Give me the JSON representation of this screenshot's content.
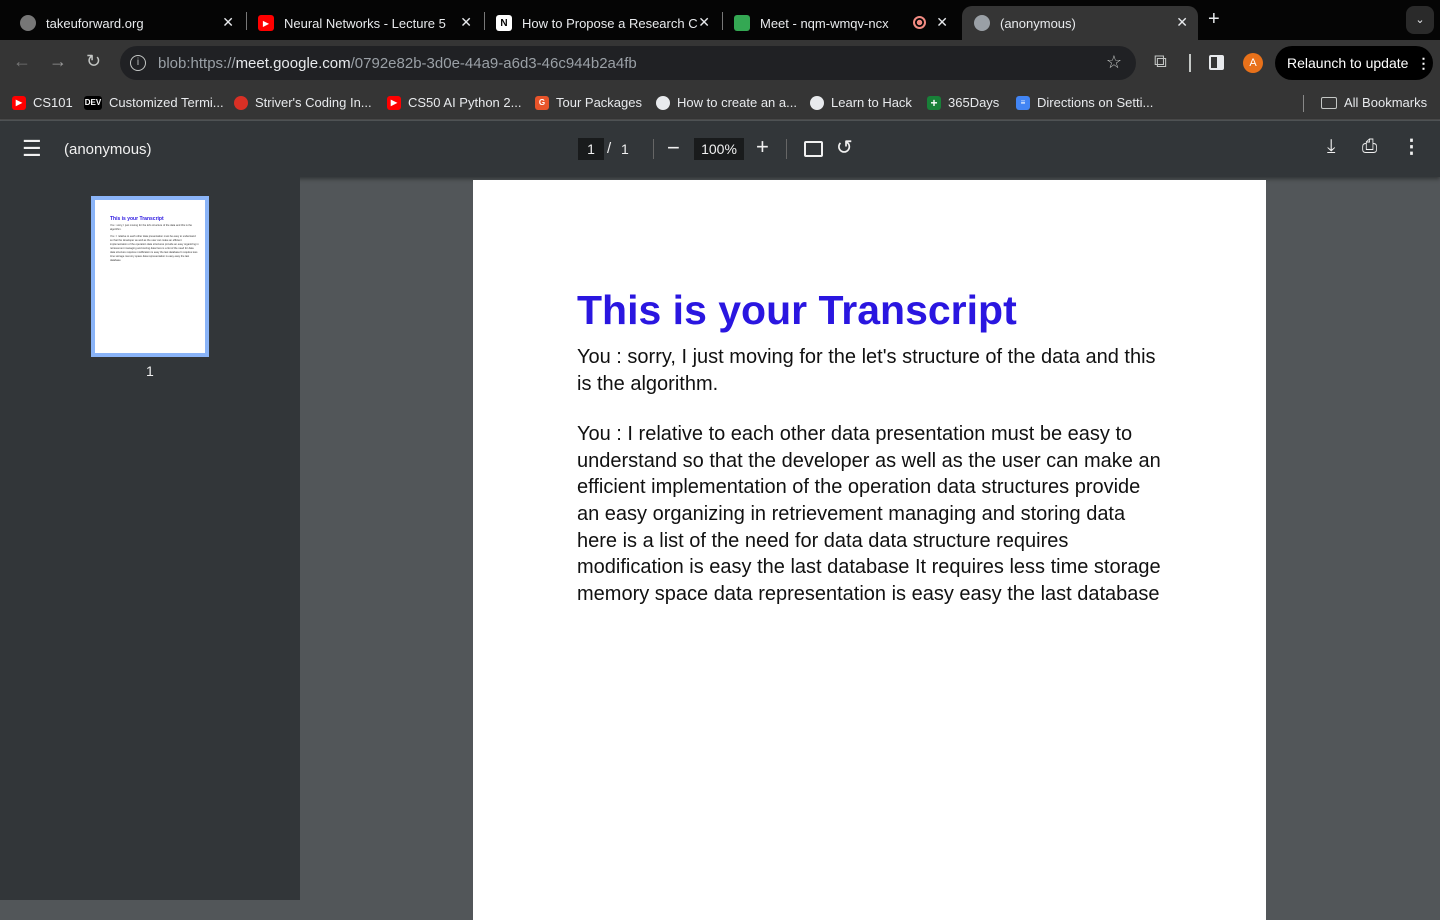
{
  "tabs": [
    {
      "title": "takeuforward.org",
      "color": "#777777"
    },
    {
      "title": "Neural Networks - Lecture 5",
      "color": "#ff0000"
    },
    {
      "title": "How to Propose a Research C",
      "color": "#222222"
    },
    {
      "title": "Meet - nqm-wmqv-ncx",
      "color": "#34a853"
    },
    {
      "title": "(anonymous)",
      "color": "#9aa0a6",
      "active": true
    }
  ],
  "address": {
    "prefix": "blob:https://",
    "host": "meet.google.com",
    "path": "/0792e82b-3d0e-44a9-a6d3-46c944b2a4fb"
  },
  "profile_initial": "A",
  "relaunch_label": "Relaunch to update",
  "bookmarks": [
    {
      "label": "CS101",
      "color": "#ff0000"
    },
    {
      "label": "Customized Termi...",
      "color": "#000000",
      "badge": "DEV"
    },
    {
      "label": "Striver's Coding In...",
      "color": "#d93025"
    },
    {
      "label": "CS50 AI Python 2...",
      "color": "#ff0000"
    },
    {
      "label": "Tour Packages",
      "color": "#e8542a",
      "badge": "G"
    },
    {
      "label": "How to create an a...",
      "color": "#5f6368"
    },
    {
      "label": "Learn to Hack",
      "color": "#5f6368"
    },
    {
      "label": "365Days",
      "color": "#188038",
      "badge": "+"
    },
    {
      "label": "Directions on Setti...",
      "color": "#4285f4"
    }
  ],
  "all_bookmarks": "All Bookmarks",
  "pdf": {
    "title": "(anonymous)",
    "page_current": "1",
    "page_sep": "/",
    "page_total": "1",
    "zoom": "100%",
    "thumb_label": "1",
    "doc_title": "This is your Transcript",
    "paragraphs": [
      "You : sorry, I just moving for the let's structure of the data and this is the algorithm.",
      "You : I relative to each other data presentation must be easy to understand so that the developer as well as the user can make an efficient implementation of the operation data structures provide an easy organizing in retrievement managing and storing data here is a list of the need for data data structure requires modification is easy the last database It requires less time storage memory space data representation is easy easy the last database"
    ]
  }
}
